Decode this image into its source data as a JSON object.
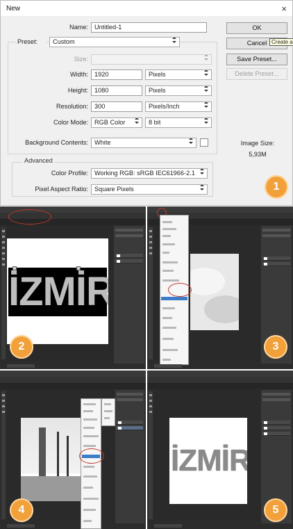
{
  "dialog": {
    "title": "New",
    "close_glyph": "×",
    "labels": {
      "name": "Name:",
      "preset": "Preset:",
      "size": "Size:",
      "width": "Width:",
      "height": "Height:",
      "resolution": "Resolution:",
      "color_mode": "Color Mode:",
      "background": "Background Contents:",
      "advanced": "Advanced",
      "color_profile": "Color Profile:",
      "pixel_aspect": "Pixel Aspect Ratio:",
      "image_size": "Image Size:"
    },
    "values": {
      "name": "Untitled-1",
      "preset": "Custom",
      "size": "",
      "width": "1920",
      "width_unit": "Pixels",
      "height": "1080",
      "height_unit": "Pixels",
      "resolution": "300",
      "resolution_unit": "Pixels/Inch",
      "color_mode": "RGB Color",
      "bit_depth": "8 bit",
      "background": "White",
      "color_profile": "Working RGB:  sRGB IEC61966-2.1",
      "pixel_aspect": "Square Pixels",
      "image_size": "5,93M"
    },
    "buttons": {
      "ok": "OK",
      "cancel": "Cancel",
      "save_preset": "Save Preset...",
      "delete_preset": "Delete Preset..."
    },
    "tooltip": "Create a new document"
  },
  "steps": {
    "s1": "1",
    "s2": "2",
    "s3": "3",
    "s4": "4",
    "s5": "5"
  },
  "screens": {
    "izmir_text": "İZMİR"
  },
  "colors": {
    "badge": "#f2a03a",
    "highlight_ring": "#c0392b",
    "menu_highlight": "#3d7cc9"
  }
}
